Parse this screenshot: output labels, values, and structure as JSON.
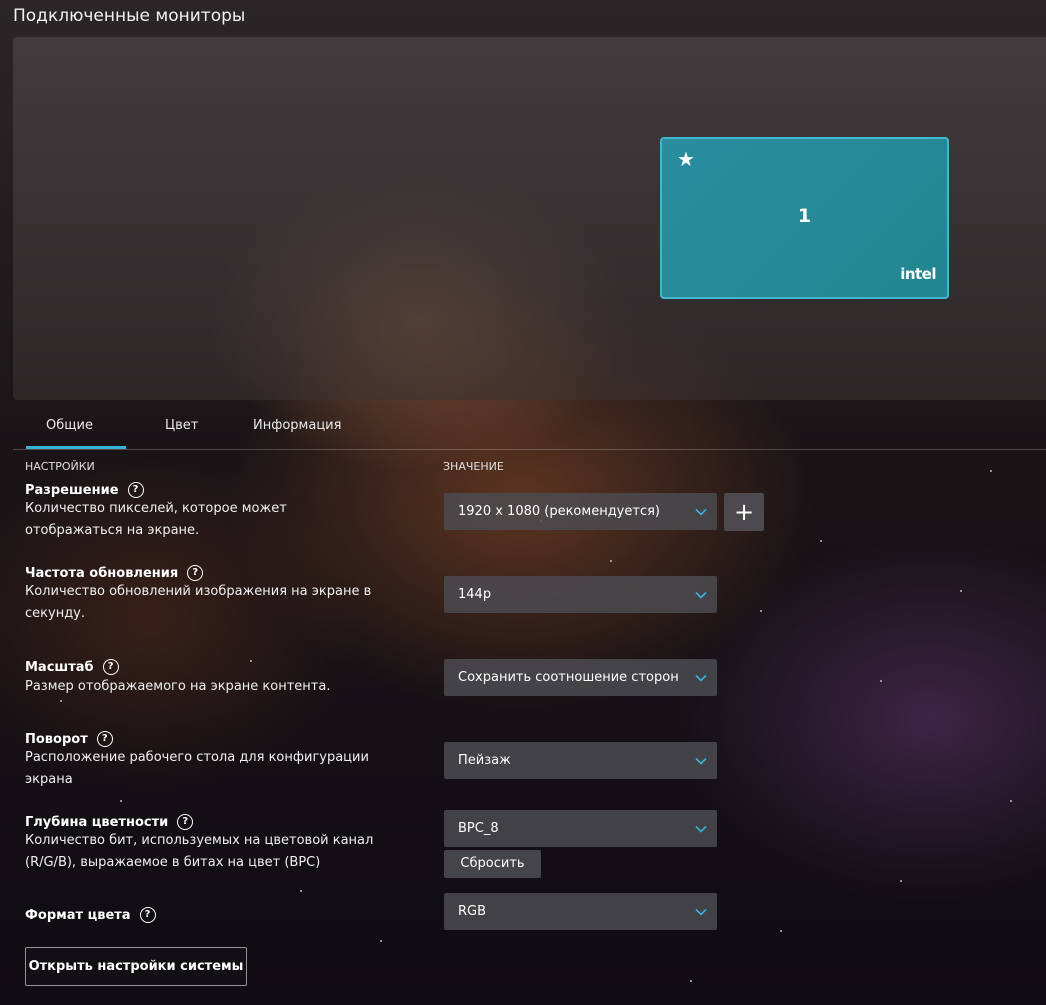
{
  "page_title": "Подключенные мониторы",
  "monitor": {
    "number": "1",
    "brand": "intel",
    "primary_icon": "star-icon"
  },
  "tabs": [
    {
      "label": "Общие",
      "active": true
    },
    {
      "label": "Цвет",
      "active": false
    },
    {
      "label": "Информация",
      "active": false
    }
  ],
  "columns": {
    "settings": "НАСТРОЙКИ",
    "value": "ЗНАЧЕНИЕ"
  },
  "settings": {
    "resolution": {
      "name": "Разрешение",
      "desc": "Количество пикселей, которое может отображаться на экране.",
      "value": "1920 x 1080 (рекомендуется)"
    },
    "refresh": {
      "name": "Частота обновления",
      "desc": "Количество обновлений изображения на экране в секунду.",
      "value": "144р"
    },
    "scale": {
      "name": "Масштаб",
      "desc": "Размер отображаемого на экране контента.",
      "value": "Сохранить соотношение сторон"
    },
    "rotation": {
      "name": "Поворот",
      "desc": "Расположение рабочего стола для конфигурации экрана",
      "value": "Пейзаж"
    },
    "color_depth": {
      "name": "Глубина цветности",
      "desc": "Количество бит, используемых на цветовой канал (R/G/B), выражаемое в битах на цвет (BPC)",
      "value": "BPC_8"
    },
    "color_format": {
      "name": "Формат цвета",
      "value": "RGB"
    }
  },
  "buttons": {
    "reset": "Сбросить",
    "open_system": "Открыть настройки системы",
    "add": "+"
  },
  "help_glyph": "?",
  "colors": {
    "accent": "#3ab2d6",
    "monitor_fill": "#228690"
  }
}
